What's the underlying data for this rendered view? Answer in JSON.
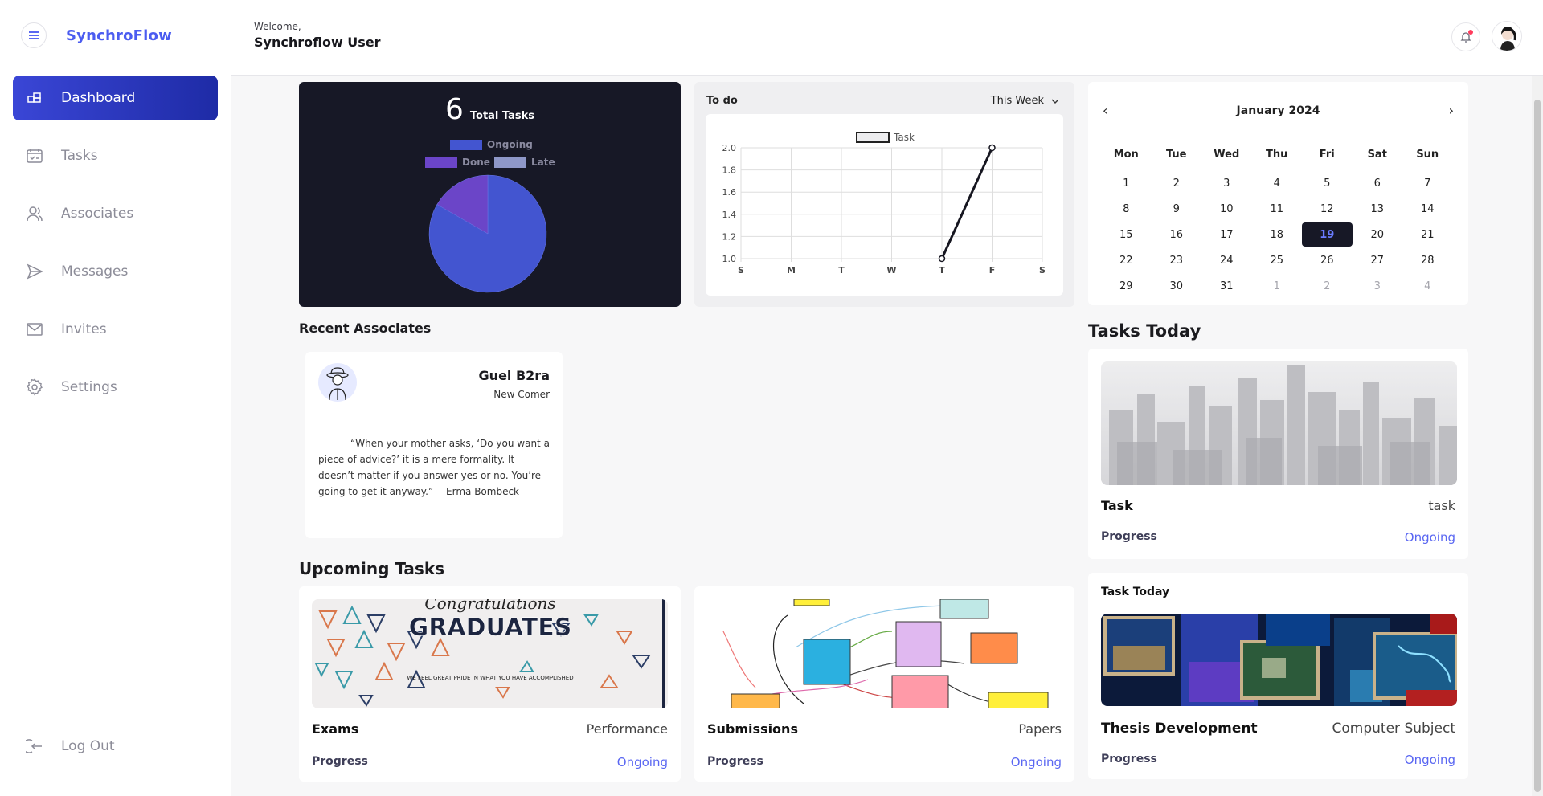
{
  "brand": {
    "name": "SynchroFlow"
  },
  "sidebar": {
    "items": [
      {
        "label": "Dashboard",
        "icon": "dashboard-icon",
        "active": true
      },
      {
        "label": "Tasks",
        "icon": "calendar-check-icon"
      },
      {
        "label": "Associates",
        "icon": "people-icon"
      },
      {
        "label": "Messages",
        "icon": "send-icon"
      },
      {
        "label": "Invites",
        "icon": "mail-icon"
      },
      {
        "label": "Settings",
        "icon": "gear-icon"
      }
    ],
    "logout_label": "Log Out"
  },
  "header": {
    "welcome": "Welcome,",
    "user": "Synchroflow User"
  },
  "summary": {
    "count": "6",
    "label": "Total Tasks",
    "legend": {
      "ongoing": "Ongoing",
      "done": "Done",
      "late": "Late"
    }
  },
  "todo": {
    "title": "To do",
    "range": "This Week"
  },
  "calendar": {
    "month": "January 2024",
    "prev": "‹",
    "next": "›",
    "weekdays": [
      "Mon",
      "Tue",
      "Wed",
      "Thu",
      "Fri",
      "Sat",
      "Sun"
    ],
    "days": [
      [
        "1",
        "2",
        "3",
        "4",
        "5",
        "6",
        "7"
      ],
      [
        "8",
        "9",
        "10",
        "11",
        "12",
        "13",
        "14"
      ],
      [
        "15",
        "16",
        "17",
        "18",
        "19",
        "20",
        "21"
      ],
      [
        "22",
        "23",
        "24",
        "25",
        "26",
        "27",
        "28"
      ],
      [
        "29",
        "30",
        "31",
        "1",
        "2",
        "3",
        "4"
      ]
    ],
    "selected": "19"
  },
  "recent_associates": {
    "title": "Recent Associates",
    "card": {
      "name": "Guel B2ra",
      "role": "New Comer",
      "quote": "“When your mother asks, ‘Do you want a piece of advice?’ it is a mere formality. It doesn’t matter if you answer yes or no. You’re going to get it anyway.” —Erma Bombeck"
    }
  },
  "upcoming": {
    "title": "Upcoming Tasks",
    "tasks": [
      {
        "name": "Exams",
        "category": "Performance",
        "progress_label": "Progress",
        "status": "Ongoing",
        "banner_line1": "Congratulations",
        "banner_line2": "GRADUATES",
        "banner_line3": "WE FEEL GREAT PRIDE IN WHAT YOU HAVE ACCOMPLISHED"
      },
      {
        "name": "Submissions",
        "category": "Papers",
        "progress_label": "Progress",
        "status": "Ongoing"
      }
    ]
  },
  "tasks_today": {
    "title": "Tasks Today",
    "task": {
      "name": "Task",
      "category": "task",
      "progress_label": "Progress",
      "status": "Ongoing"
    },
    "second_title": "Task Today",
    "second": {
      "name": "Thesis Development",
      "category": "Computer Subject",
      "progress_label": "Progress",
      "status": "Ongoing"
    }
  },
  "colors": {
    "accent": "#4b5cf0",
    "ongoing": "#4355d0",
    "done": "#6b45c8",
    "late": "#8e97c8"
  },
  "chart_data": [
    {
      "type": "pie",
      "title": "",
      "categories": [
        "Ongoing",
        "Done",
        "Late"
      ],
      "values": [
        5,
        1,
        0
      ]
    },
    {
      "type": "line",
      "title": "",
      "categories": [
        "S",
        "M",
        "T",
        "W",
        "T",
        "F",
        "S"
      ],
      "series": [
        {
          "name": "Task",
          "values": [
            null,
            null,
            null,
            null,
            1,
            2,
            null
          ]
        }
      ],
      "ylim": [
        1.0,
        2.0
      ],
      "yticks": [
        "1.0",
        "1.2",
        "1.4",
        "1.6",
        "1.8",
        "2.0"
      ],
      "grid": true,
      "legend": "top"
    }
  ]
}
